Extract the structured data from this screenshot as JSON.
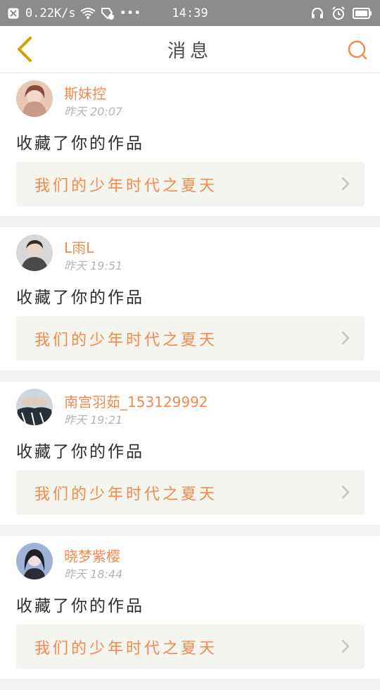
{
  "status_bar": {
    "speed": "0.22K/s",
    "dots": "•••",
    "time": "14:39"
  },
  "header": {
    "title": "消息",
    "back_icon": "chevron-left-icon",
    "search_icon": "search-icon"
  },
  "colors": {
    "accent": "#f2894f",
    "status_bar_bg": "#8c8c8c",
    "card_inner_bg": "#f4f4ee",
    "back_icon": "#c9a400"
  },
  "notifications": [
    {
      "name": "斯妹控",
      "time": "昨天 20:07",
      "action": "收藏了你的作品",
      "work_title": "我们的少年时代之夏天",
      "avatar_color": "#c89a8a"
    },
    {
      "name": "L雨L",
      "time": "昨天 19:51",
      "action": "收藏了你的作品",
      "work_title": "我们的少年时代之夏天",
      "avatar_color": "#5a5a5a"
    },
    {
      "name": "南宫羽茹_153129992",
      "time": "昨天 19:21",
      "action": "收藏了你的作品",
      "work_title": "我们的少年时代之夏天",
      "avatar_color": "#3b4653"
    },
    {
      "name": "晓梦紫樱",
      "time": "昨天 18:44",
      "action": "收藏了你的作品",
      "work_title": "我们的少年时代之夏天",
      "avatar_color": "#6f86b9"
    }
  ]
}
